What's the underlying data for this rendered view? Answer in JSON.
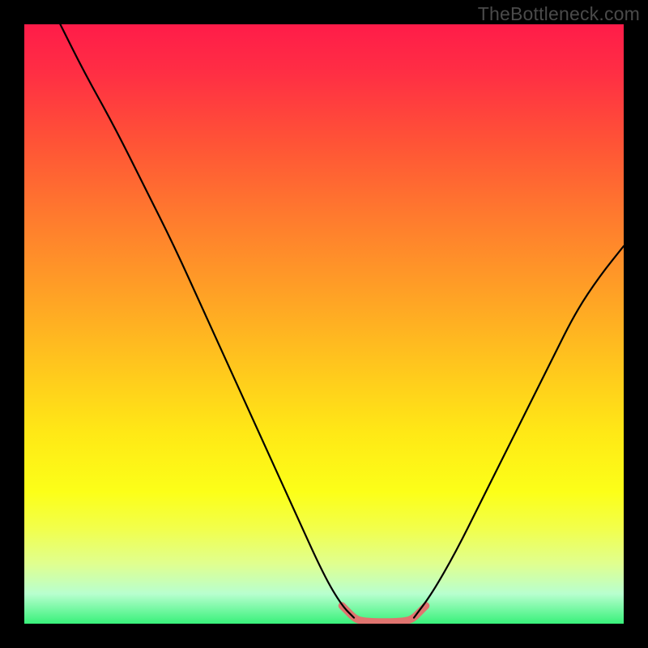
{
  "watermark": "TheBottleneck.com",
  "chart_data": {
    "type": "line",
    "title": "",
    "xlabel": "",
    "ylabel": "",
    "xlim": [
      0,
      100
    ],
    "ylim": [
      0,
      100
    ],
    "gradient_stops": [
      {
        "pos": 0,
        "color": "#ff1c49"
      },
      {
        "pos": 8,
        "color": "#ff2e44"
      },
      {
        "pos": 20,
        "color": "#ff5436"
      },
      {
        "pos": 32,
        "color": "#ff7a2e"
      },
      {
        "pos": 44,
        "color": "#ff9e26"
      },
      {
        "pos": 56,
        "color": "#ffc31e"
      },
      {
        "pos": 68,
        "color": "#ffe816"
      },
      {
        "pos": 78,
        "color": "#fcff18"
      },
      {
        "pos": 84,
        "color": "#f2ff4a"
      },
      {
        "pos": 90,
        "color": "#e0ff8f"
      },
      {
        "pos": 95,
        "color": "#b8ffcf"
      },
      {
        "pos": 100,
        "color": "#38f17a"
      }
    ],
    "series": [
      {
        "name": "left-curve",
        "stroke": "#000000",
        "stroke_width": 2.2,
        "x": [
          6,
          10,
          15,
          20,
          25,
          30,
          35,
          40,
          45,
          50,
          53,
          55
        ],
        "y": [
          100,
          92,
          83,
          73,
          63,
          52,
          41,
          30,
          19,
          8,
          3,
          1
        ]
      },
      {
        "name": "right-curve",
        "stroke": "#000000",
        "stroke_width": 2.2,
        "x": [
          65,
          68,
          72,
          76,
          80,
          84,
          88,
          92,
          96,
          100
        ],
        "y": [
          1,
          5,
          12,
          20,
          28,
          36,
          44,
          52,
          58,
          63
        ]
      },
      {
        "name": "valley-highlight",
        "stroke": "#e0746f",
        "stroke_width": 9,
        "x": [
          53,
          54,
          55,
          56,
          58,
          60,
          62,
          64,
          65,
          66,
          67
        ],
        "y": [
          3,
          2,
          1,
          0.5,
          0.3,
          0.3,
          0.3,
          0.5,
          1,
          2,
          3
        ]
      }
    ]
  }
}
